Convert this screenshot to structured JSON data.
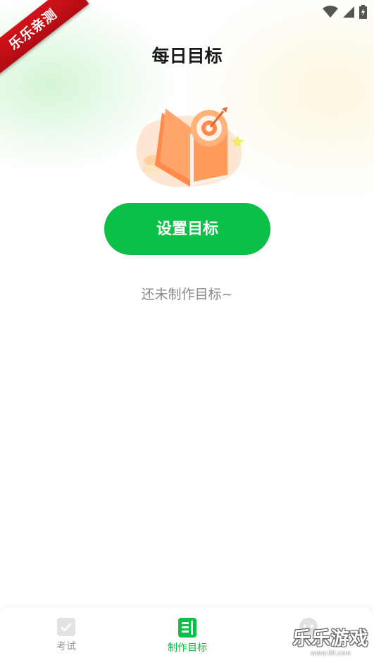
{
  "ribbon": {
    "text": "乐乐亲测"
  },
  "header": {
    "title": "每日目标"
  },
  "main": {
    "set_goal_button": "设置目标",
    "empty_message": "还未制作目标~"
  },
  "bottom_nav": {
    "items": [
      {
        "label": "考试",
        "icon": "exam-icon",
        "active": false
      },
      {
        "label": "制作目标",
        "icon": "goal-icon",
        "active": true
      },
      {
        "label": "",
        "icon": "chat-icon",
        "active": false
      }
    ]
  },
  "watermark": {
    "main": "乐乐游戏",
    "url": "www.6ll.com"
  },
  "colors": {
    "accent": "#0cbf46",
    "title": "#1a1a1a",
    "muted": "#8a8a8a",
    "ribbon": "#c8111a"
  }
}
